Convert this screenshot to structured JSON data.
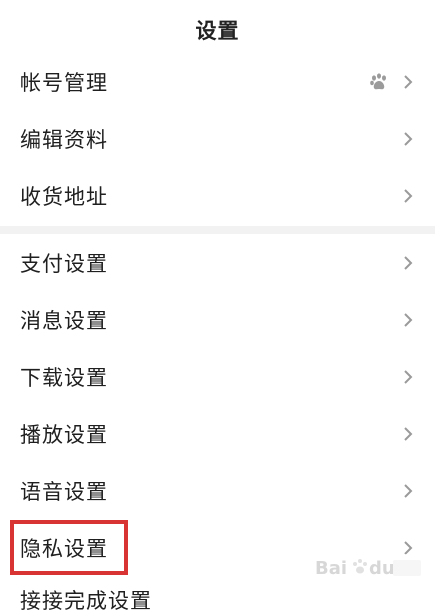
{
  "header": {
    "title": "设置"
  },
  "groups": [
    {
      "items": [
        {
          "label": "帐号管理",
          "has_paw": true
        },
        {
          "label": "编辑资料",
          "has_paw": false
        },
        {
          "label": "收货地址",
          "has_paw": false
        }
      ]
    },
    {
      "items": [
        {
          "label": "支付设置",
          "has_paw": false
        },
        {
          "label": "消息设置",
          "has_paw": false
        },
        {
          "label": "下载设置",
          "has_paw": false
        },
        {
          "label": "播放设置",
          "has_paw": false
        },
        {
          "label": "语音设置",
          "has_paw": false
        },
        {
          "label": "隐私设置",
          "has_paw": false
        }
      ]
    }
  ],
  "cutoff_item": {
    "label": "接接完成设置"
  },
  "icons": {
    "chevron": "chevron-right-icon",
    "paw": "baidu-paw-icon"
  },
  "colors": {
    "highlight": "#d83434",
    "divider": "#f2f2f2",
    "chevron": "#9a9a9a"
  }
}
